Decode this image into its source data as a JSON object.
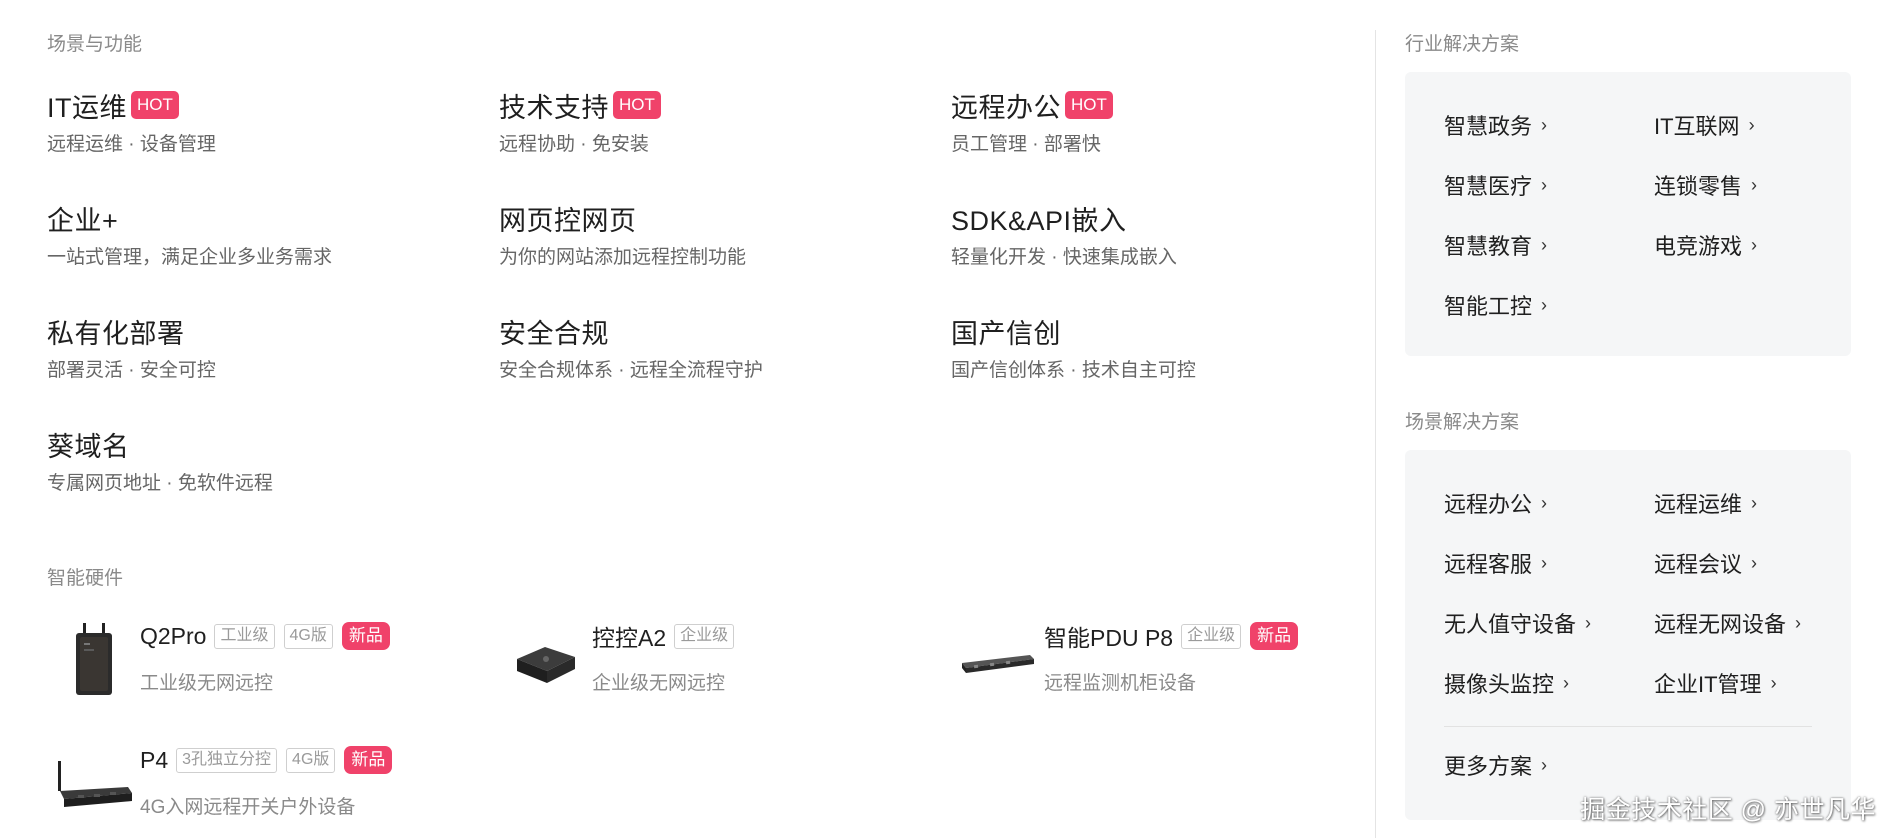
{
  "scenes": {
    "heading": "场景与功能",
    "items": [
      {
        "title": "IT运维",
        "badge": "HOT",
        "desc": "远程运维 · 设备管理"
      },
      {
        "title": "技术支持",
        "badge": "HOT",
        "desc": "远程协助 · 免安装"
      },
      {
        "title": "远程办公",
        "badge": "HOT",
        "desc": "员工管理 · 部署快"
      },
      {
        "title": "企业+",
        "desc": "一站式管理，满足企业多业务需求"
      },
      {
        "title": "网页控网页",
        "desc": "为你的网站添加远程控制功能"
      },
      {
        "title": "SDK&API嵌入",
        "desc": "轻量化开发 · 快速集成嵌入"
      },
      {
        "title": "私有化部署",
        "desc": "部署灵活 · 安全可控"
      },
      {
        "title": "安全合规",
        "desc": "安全合规体系 · 远程全流程守护"
      },
      {
        "title": "国产信创",
        "desc": "国产信创体系 · 技术自主可控"
      },
      {
        "title": "葵域名",
        "desc": "专属网页地址 · 免软件远程"
      }
    ]
  },
  "hardware": {
    "heading": "智能硬件",
    "items": [
      {
        "name": "Q2Pro",
        "tags": [
          "工业级",
          "4G版"
        ],
        "badge": "新品",
        "desc": "工业级无网远控",
        "icon": "industrial-router-image"
      },
      {
        "name": "控控A2",
        "tags": [
          "企业级"
        ],
        "desc": "企业级无网远控",
        "icon": "kvm-box-image"
      },
      {
        "name": "智能PDU P8",
        "tags": [
          "企业级"
        ],
        "badge": "新品",
        "desc": "远程监测机柜设备",
        "icon": "rack-pdu-image"
      },
      {
        "name": "P4",
        "tags": [
          "3孔独立分控",
          "4G版"
        ],
        "badge": "新品",
        "desc": "4G入网远程开关户外设备",
        "icon": "power-strip-image"
      }
    ]
  },
  "industry": {
    "heading": "行业解决方案",
    "items": [
      "智慧政务",
      "IT互联网",
      "智慧医疗",
      "连锁零售",
      "智慧教育",
      "电竞游戏",
      "智能工控"
    ]
  },
  "scenario": {
    "heading": "场景解决方案",
    "items": [
      "远程办公",
      "远程运维",
      "远程客服",
      "远程会议",
      "无人值守设备",
      "远程无网设备",
      "摄像头监控",
      "企业IT管理"
    ],
    "more": "更多方案"
  },
  "chevron_icon": "chevron-right-icon",
  "watermark": "掘金技术社区 @ 亦世凡华",
  "colors": {
    "hot": "#f0426a",
    "panel_bg": "#f5f6f7"
  }
}
